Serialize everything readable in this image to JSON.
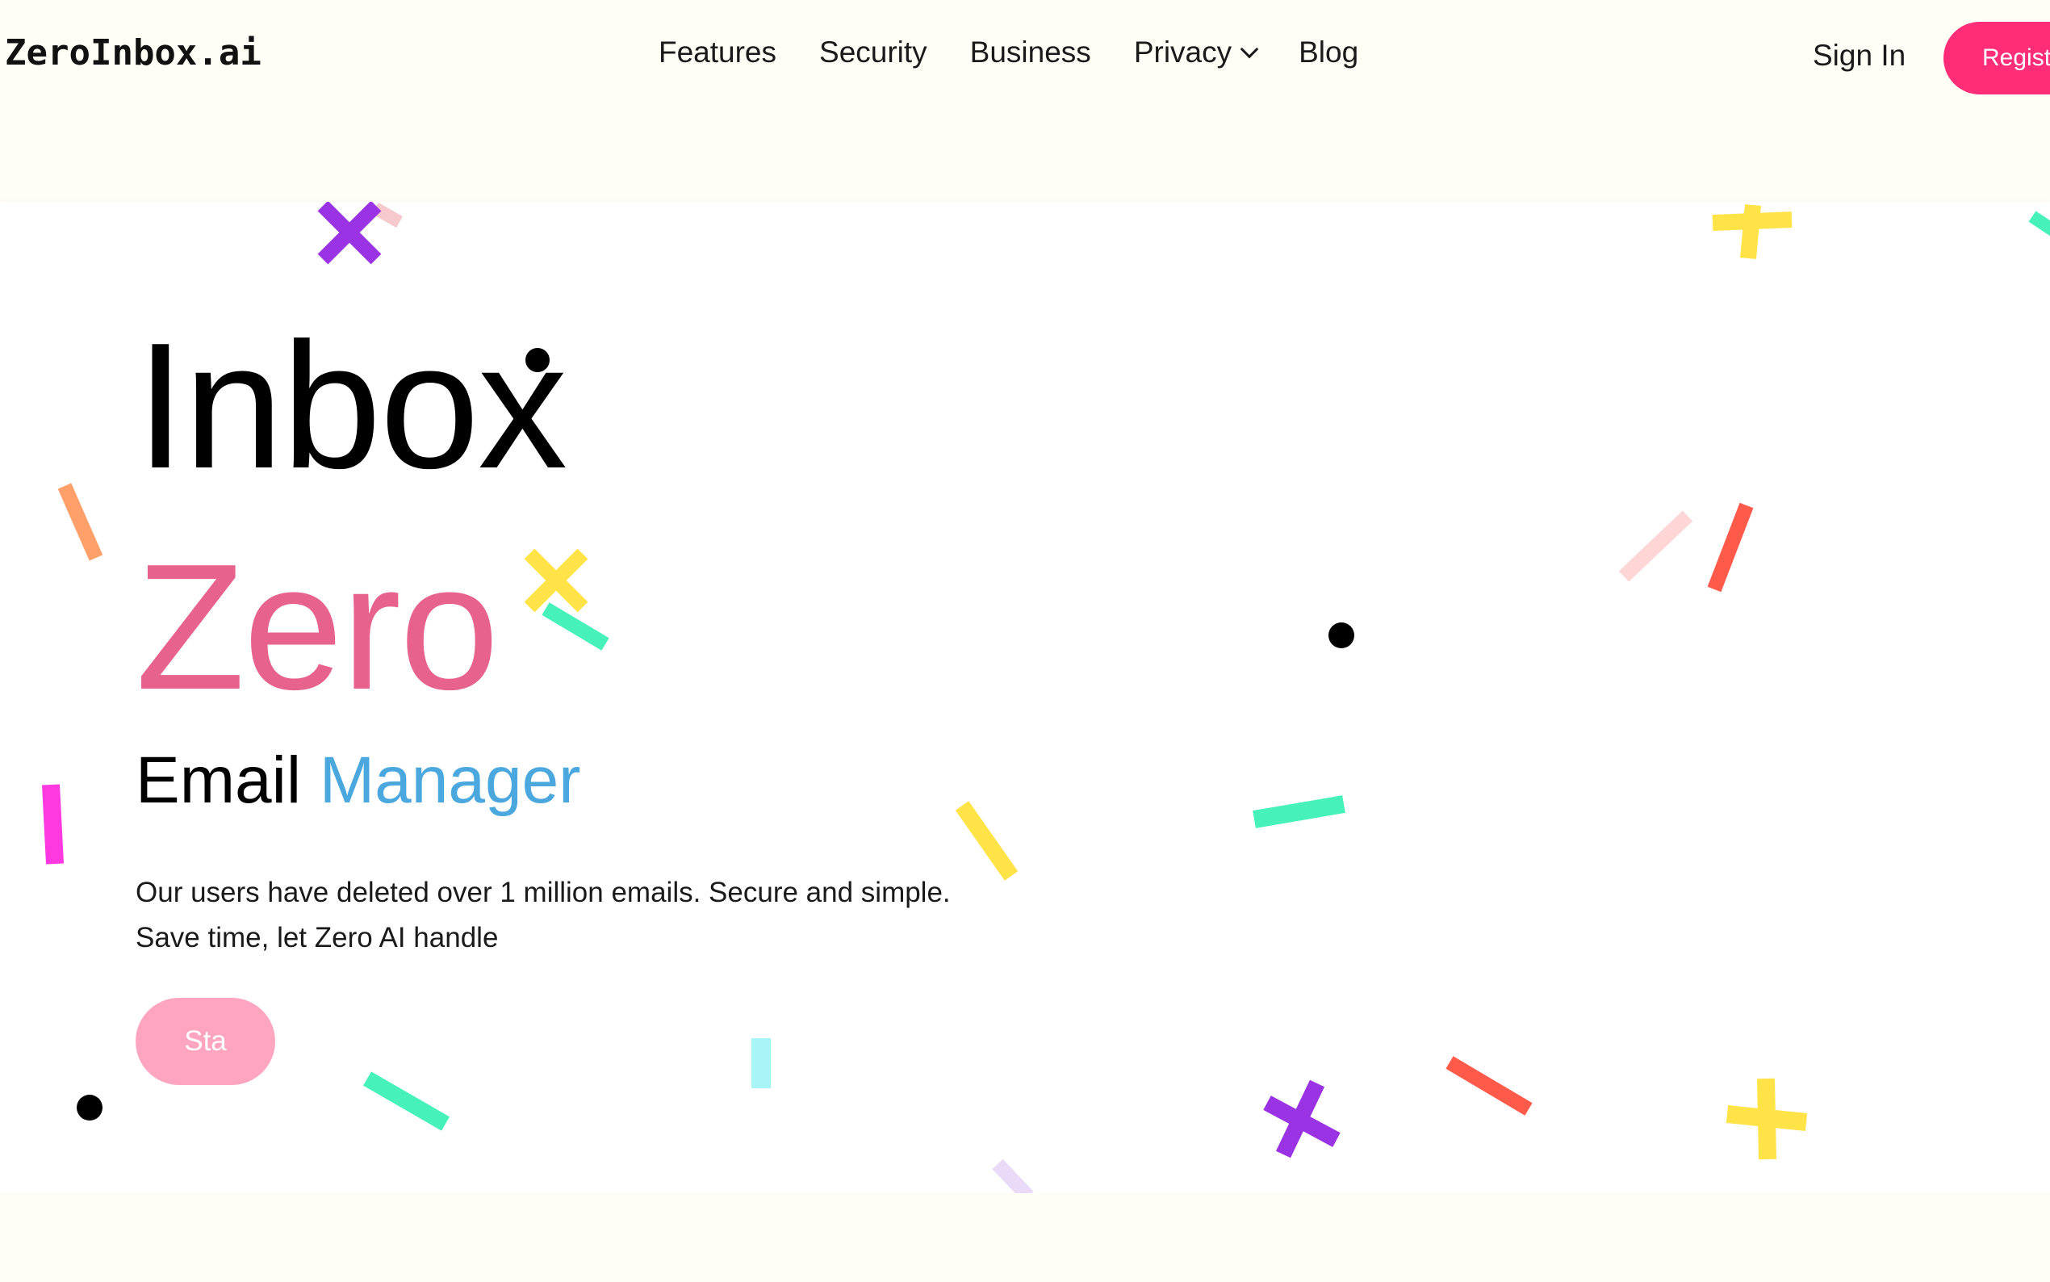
{
  "brand": {
    "logo": "ZeroInbox.ai"
  },
  "nav": {
    "items": [
      "Features",
      "Security",
      "Business",
      "Privacy",
      "Blog"
    ]
  },
  "auth": {
    "signin_label": "Sign In",
    "register_label": "Regist"
  },
  "hero": {
    "title_line1": "Inbox",
    "title_line2": "Zero",
    "subtitle_word1": "Email",
    "subtitle_word2": "Manager",
    "tagline_line1": "Our users have deleted over 1 million emails. Secure and simple.",
    "tagline_line2": "Save time, let Zero AI handle",
    "cta_label": "Sta"
  },
  "colors": {
    "background": "#fffef6",
    "hero_background": "#ffffff",
    "zero_pink": "#e8628e",
    "manager_blue": "#4aa8de",
    "register_pink": "#ff2d78",
    "cta_pink": "#ffa5bf"
  },
  "icons": {
    "privacy_dropdown": "chevron-down-icon"
  }
}
